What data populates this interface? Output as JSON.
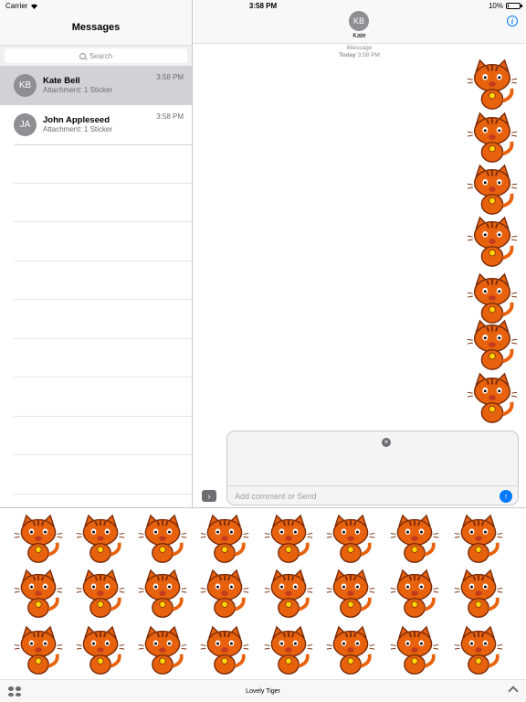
{
  "status_bar": {
    "carrier": "Carrier",
    "time": "3:58 PM",
    "battery": "10%",
    "battery_level": 0.1
  },
  "sidebar": {
    "title": "Messages",
    "search_placeholder": "Search",
    "conversations": [
      {
        "initials": "KB",
        "name": "Kate Bell",
        "preview": "Attachment: 1 Sticker",
        "time": "3:58 PM",
        "selected": true
      },
      {
        "initials": "JA",
        "name": "John Appleseed",
        "preview": "Attachment: 1 Sticker",
        "time": "3:58 PM",
        "selected": false
      }
    ]
  },
  "conversation": {
    "contact_initials": "KB",
    "contact_name": "Kate",
    "service": "iMessage",
    "day": "Today",
    "time": "3:58 PM",
    "comment_placeholder": "Add comment or Send"
  },
  "app_drawer": {
    "name": "Lovely Tiger"
  },
  "colors": {
    "accent": "#007aff",
    "tiger_orange": "#e8620e",
    "tiger_dark": "#7a2b0a",
    "selected_row": "#d1d1d6"
  }
}
